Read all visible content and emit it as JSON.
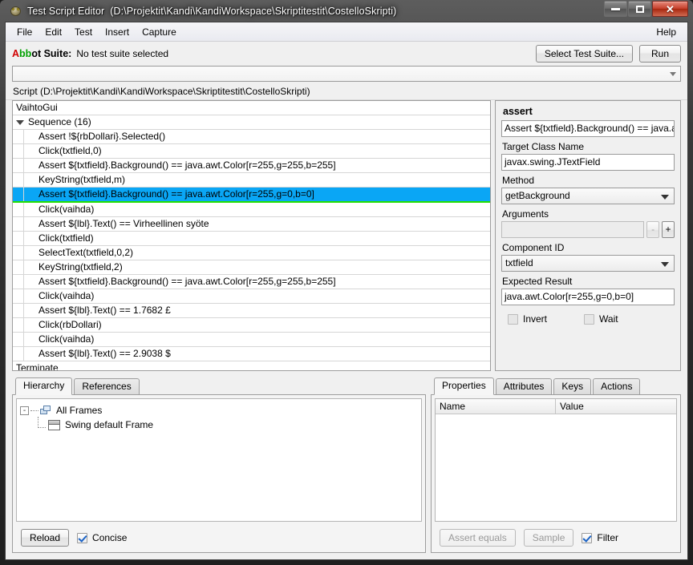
{
  "window": {
    "title": "Test Script Editor",
    "path": "(D:\\Projektit\\Kandi\\KandiWorkspace\\Skriptitestit\\CostelloSkripti)",
    "app_icon": "abbot-icon",
    "minimize_label": "Minimize",
    "maximize_label": "Maximize",
    "close_label": "Close"
  },
  "menubar": {
    "items": [
      {
        "label": "File"
      },
      {
        "label": "Edit"
      },
      {
        "label": "Test"
      },
      {
        "label": "Insert"
      },
      {
        "label": "Capture"
      }
    ],
    "help_label": "Help"
  },
  "suitebar": {
    "logo_a": "A",
    "logo_bb": "bb",
    "logo_rest": "ot Suite:",
    "status": "No test suite selected",
    "select_suite_button": "Select Test Suite...",
    "run_button": "Run"
  },
  "script_combo": {
    "value": "",
    "icon": "chevron-down-icon"
  },
  "script_label": "Script (D:\\Projektit\\Kandi\\KandiWorkspace\\Skriptitestit\\CostelloSkripti)",
  "script_tree": {
    "root": "VaihtoGui",
    "sequence_label": "Sequence (16)",
    "steps": [
      {
        "text": "Assert !${rbDollari}.Selected()",
        "selected": false
      },
      {
        "text": "Click(txtfield,0)",
        "selected": false
      },
      {
        "text": "Assert ${txtfield}.Background() == java.awt.Color[r=255,g=255,b=255]",
        "selected": false
      },
      {
        "text": "KeyString(txtfield,m)",
        "selected": false
      },
      {
        "text": "Assert ${txtfield}.Background() == java.awt.Color[r=255,g=0,b=0]",
        "selected": true
      },
      {
        "text": "Click(vaihda)",
        "selected": false
      },
      {
        "text": "Assert ${lbl}.Text() == Virheellinen syöte",
        "selected": false
      },
      {
        "text": "Click(txtfield)",
        "selected": false
      },
      {
        "text": "SelectText(txtfield,0,2)",
        "selected": false
      },
      {
        "text": "KeyString(txtfield,2)",
        "selected": false
      },
      {
        "text": "Assert ${txtfield}.Background() == java.awt.Color[r=255,g=255,b=255]",
        "selected": false
      },
      {
        "text": "Click(vaihda)",
        "selected": false
      },
      {
        "text": "Assert ${lbl}.Text() == 1.7682 £",
        "selected": false
      },
      {
        "text": "Click(rbDollari)",
        "selected": false
      },
      {
        "text": "Click(vaihda)",
        "selected": false
      },
      {
        "text": "Assert ${lbl}.Text() == 2.9038 $",
        "selected": false
      }
    ],
    "terminate_label": "Terminate"
  },
  "assert_panel": {
    "title": "assert",
    "description_value": "Assert ${txtfield}.Background() == java.aw",
    "target_class_label": "Target Class Name",
    "target_class_value": "javax.swing.JTextField",
    "method_label": "Method",
    "method_value": "getBackground",
    "arguments_label": "Arguments",
    "arguments_value": "",
    "arg_remove_button": "-",
    "arg_add_button": "+",
    "component_id_label": "Component ID",
    "component_id_value": "txtfield",
    "expected_result_label": "Expected Result",
    "expected_result_value": "java.awt.Color[r=255,g=0,b=0]",
    "invert_label": "Invert",
    "invert_checked": false,
    "wait_label": "Wait",
    "wait_checked": false
  },
  "hierarchy_panel": {
    "tabs": [
      {
        "label": "Hierarchy",
        "active": true
      },
      {
        "label": "References",
        "active": false
      }
    ],
    "tree": {
      "root_label": "All Frames",
      "root_expander": "-",
      "child_label": "Swing default Frame"
    },
    "reload_button": "Reload",
    "concise_label": "Concise",
    "concise_checked": true
  },
  "properties_panel": {
    "tabs": [
      {
        "label": "Properties",
        "active": true
      },
      {
        "label": "Attributes",
        "active": false
      },
      {
        "label": "Keys",
        "active": false
      },
      {
        "label": "Actions",
        "active": false
      }
    ],
    "columns": [
      {
        "label": "Name"
      },
      {
        "label": "Value"
      }
    ],
    "rows": [],
    "assert_equals_button": "Assert equals",
    "assert_equals_enabled": false,
    "sample_button": "Sample",
    "sample_enabled": false,
    "filter_label": "Filter",
    "filter_checked": true
  },
  "colors": {
    "selection_blue": "#0aa6f5",
    "selection_underline_green": "#22e000",
    "logo_red": "#d00000",
    "logo_green": "#00a000",
    "close_button_red": "#c5402c"
  }
}
